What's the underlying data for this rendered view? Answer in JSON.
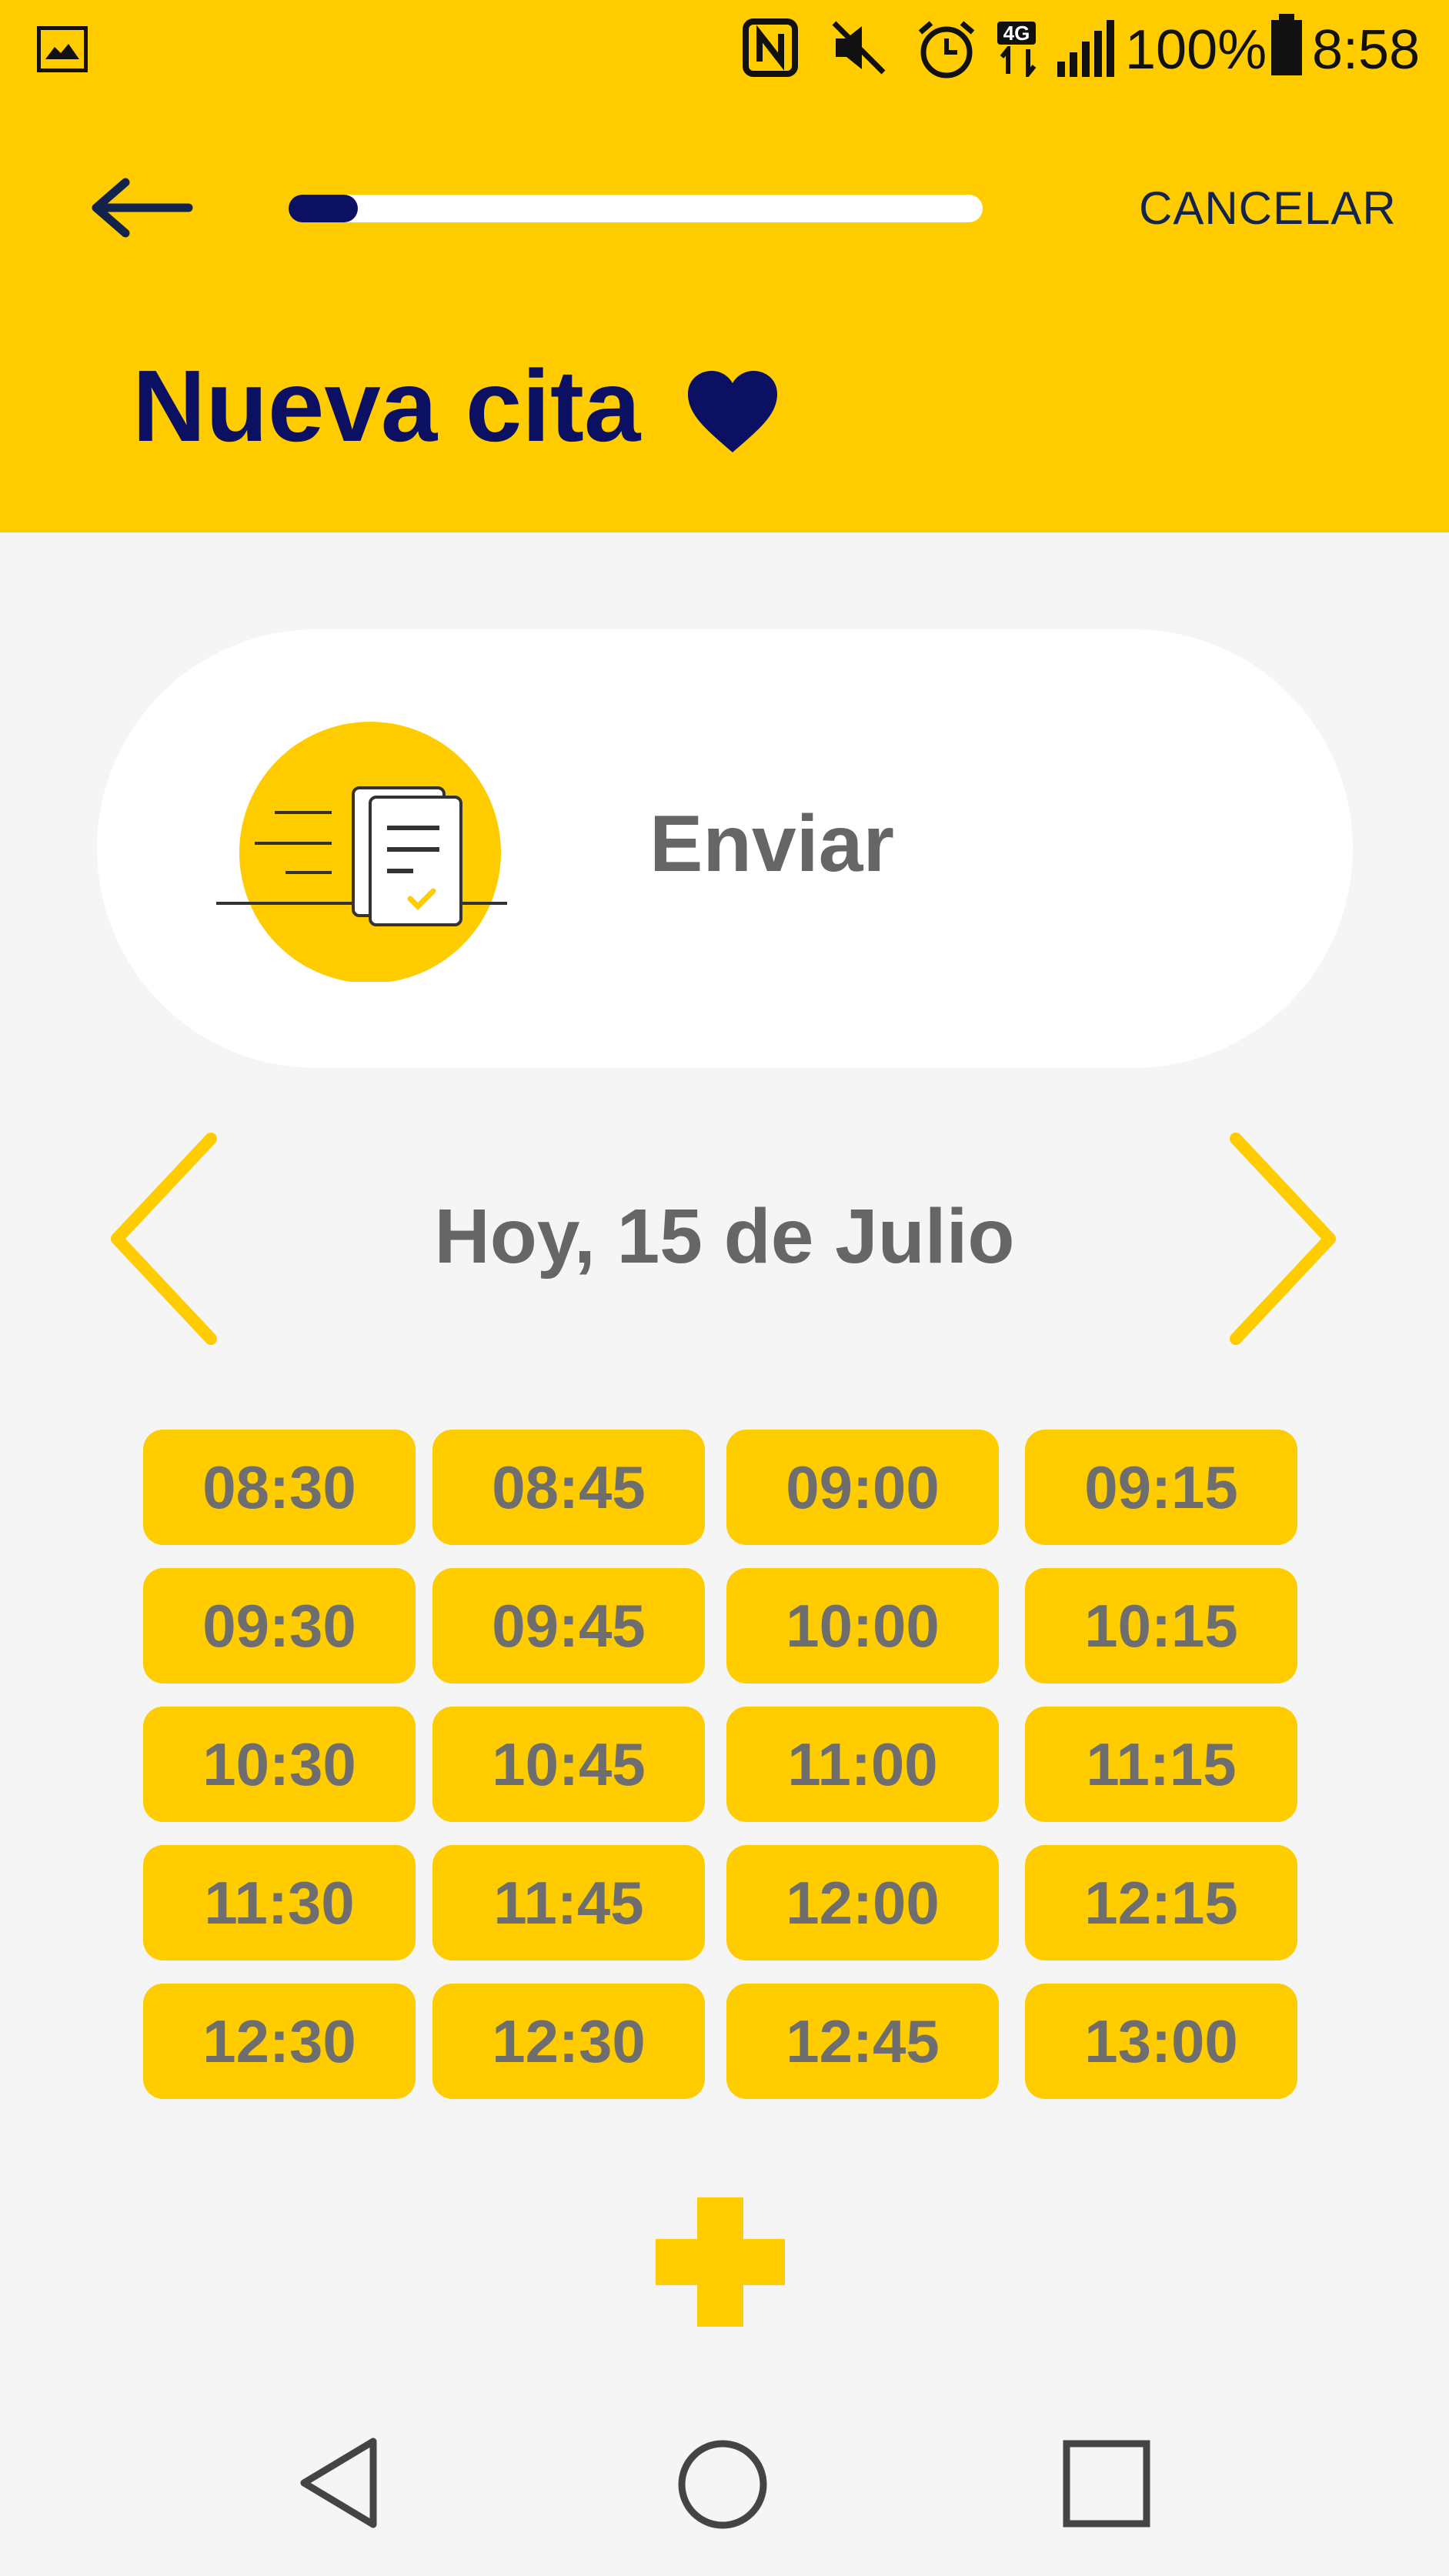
{
  "status_bar": {
    "battery": "100%",
    "time": "8:58",
    "network": "4G",
    "icons": [
      "gallery-icon",
      "nfc-icon",
      "mute-icon",
      "alarm-icon",
      "network-icon",
      "signal-icon",
      "battery-icon"
    ]
  },
  "toolbar": {
    "back_icon": "arrow-left-icon",
    "progress": 0.1,
    "cancel_label": "CANCELAR"
  },
  "page": {
    "title": "Nueva cita",
    "title_icon": "heart-icon"
  },
  "card": {
    "icon": "send-document-icon",
    "label": "Enviar"
  },
  "date_nav": {
    "label": "Hoy, 15 de Julio",
    "prev_icon": "chevron-left-icon",
    "next_icon": "chevron-right-icon"
  },
  "time_slots": [
    "08:30",
    "08:45",
    "09:00",
    "09:15",
    "09:30",
    "09:45",
    "10:00",
    "10:15",
    "10:30",
    "10:45",
    "11:00",
    "11:15",
    "11:30",
    "11:45",
    "12:00",
    "12:15",
    "12:30",
    "12:30",
    "12:45",
    "13:00"
  ],
  "add_button": {
    "icon": "plus-icon"
  },
  "nav_bar": {
    "icons": [
      "nav-back-icon",
      "nav-home-icon",
      "nav-recent-icon"
    ]
  },
  "colors": {
    "accent": "#ffcc00",
    "title": "#0b1063",
    "text_gray": "#666666",
    "background": "#f5f5f5"
  }
}
